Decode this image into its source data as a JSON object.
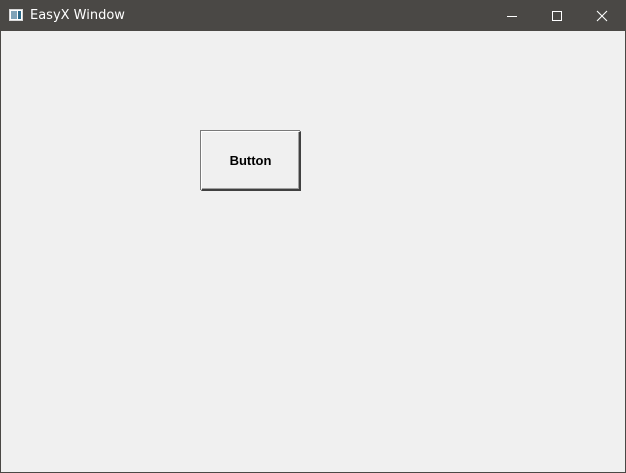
{
  "window": {
    "title": "EasyX Window",
    "titlebar_color": "#4a4845",
    "background_color": "#f0f0f0"
  },
  "controls": {
    "minimize_icon": "minimize-icon",
    "maximize_icon": "maximize-icon",
    "close_icon": "close-icon"
  },
  "client": {
    "button_label": "Button"
  }
}
